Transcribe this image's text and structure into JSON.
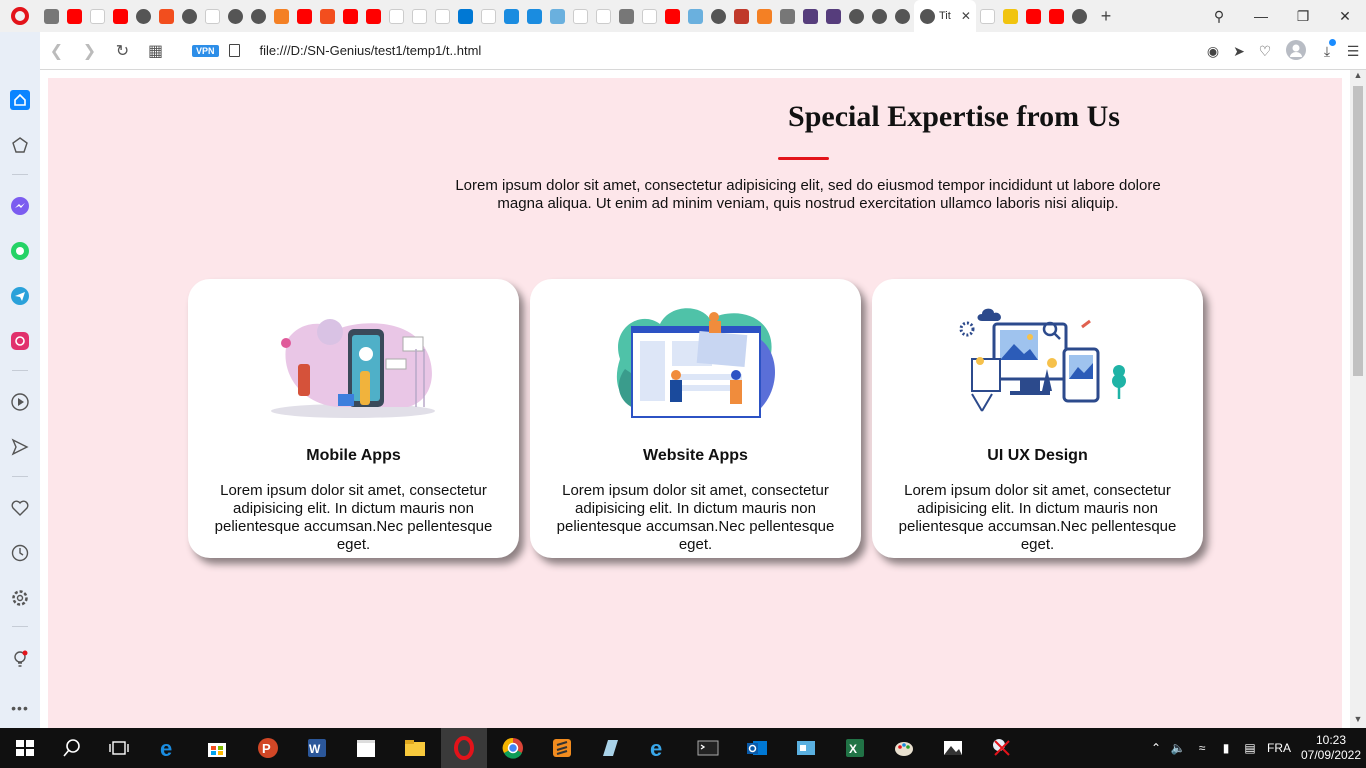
{
  "browser": {
    "active_tab_title": "Tit",
    "tab_favicons": [
      "settings",
      "youtube",
      "google",
      "youtube",
      "globe",
      "figma",
      "globe",
      "google",
      "globe",
      "globe",
      "stackoverflow",
      "youtube",
      "figma",
      "youtube",
      "youtube",
      "google",
      "wikipedia",
      "microsoft",
      "outlook",
      "google",
      "link",
      "code",
      "wave",
      "google",
      "microsoft",
      "grid",
      "microsoft",
      "youtube",
      "wave",
      "globe",
      "book",
      "stackoverflow",
      "grid",
      "bootstrap",
      "bootstrap",
      "globe",
      "globe",
      "globe"
    ],
    "after_favicons": [
      "google",
      "yellow-grid",
      "youtube",
      "youtube",
      "globe"
    ],
    "vpn_label": "VPN",
    "url": "file:///D:/SN-Genius/test1/temp1/t..html"
  },
  "section": {
    "heading": "Special Expertise from Us",
    "intro": "Lorem ipsum dolor sit amet, consectetur adipisicing elit, sed do eiusmod tempor incididunt ut labore dolore magna aliqua. Ut enim ad minim veniam, quis nostrud exercitation ullamco laboris nisi aliquip."
  },
  "cards": [
    {
      "title": "Mobile Apps",
      "text": "Lorem ipsum dolor sit amet, consectetur adipisicing elit. In dictum mauris non pelientesque accumsan.Nec pellentesque eget."
    },
    {
      "title": "Website Apps",
      "text": "Lorem ipsum dolor sit amet, consectetur adipisicing elit. In dictum mauris non pelientesque accumsan.Nec pellentesque eget."
    },
    {
      "title": "UI UX Design",
      "text": "Lorem ipsum dolor sit amet, consectetur adipisicing elit. In dictum mauris non pelientesque accumsan.Nec pellentesque eget."
    }
  ],
  "taskbar": {
    "language": "FRA",
    "time": "10:23",
    "date": "07/09/2022"
  },
  "colors": {
    "page_background": "#fde6ea",
    "accent_red": "#e3131a",
    "opera_red": "#e3131a"
  }
}
